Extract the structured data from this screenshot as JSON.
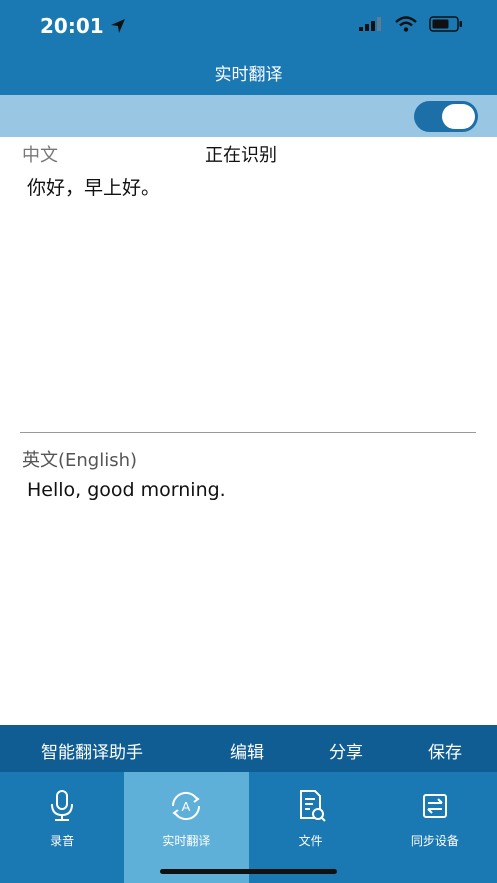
{
  "status": {
    "time": "20:01"
  },
  "header": {
    "title": "实时翻译"
  },
  "source": {
    "language": "中文",
    "status": "正在识别",
    "text": "你好，早上好。"
  },
  "target": {
    "language": "英文(English)",
    "text": "Hello, good morning."
  },
  "actions": {
    "assistant": "智能翻译助手",
    "edit": "编辑",
    "share": "分享",
    "save": "保存"
  },
  "tabs": [
    {
      "label": "录音",
      "icon": "microphone-icon"
    },
    {
      "label": "实时翻译",
      "icon": "realtime-translate-icon",
      "active": true
    },
    {
      "label": "文件",
      "icon": "file-search-icon"
    },
    {
      "label": "同步设备",
      "icon": "sync-icon"
    }
  ],
  "colors": {
    "header": "#1a78b3",
    "toggleBar": "#99c6e3",
    "actionBar": "#0f5d92",
    "activeTab": "#5fb0d8"
  },
  "toggle": {
    "on": true
  }
}
